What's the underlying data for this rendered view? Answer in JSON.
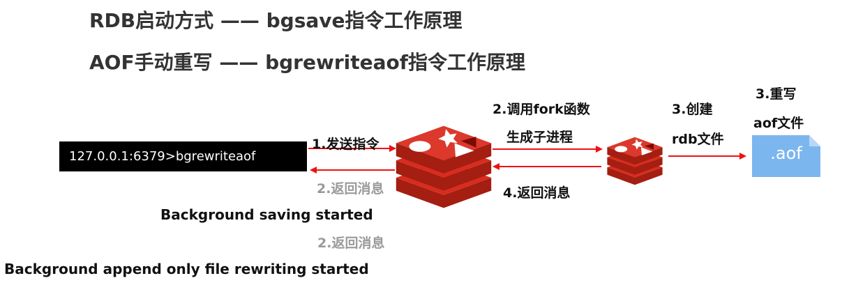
{
  "titles": {
    "rdb": "RDB启动方式 —— bgsave指令工作原理",
    "aof": "AOF手动重写 —— bgrewriteaof指令工作原理"
  },
  "client": {
    "command": "127.0.0.1:6379>bgrewriteaof"
  },
  "steps": {
    "send": "1.发送指令",
    "return_left": "2.返回消息",
    "fork_line1": "2.调用fork函数",
    "fork_line2": "生成子进程",
    "return_right": "4.返回消息",
    "create_line1": "3.创建",
    "create_line2": "rdb文件",
    "rewrite_line1": "3.重写",
    "rewrite_line2": "aof文件",
    "return_bottom": "2.返回消息"
  },
  "file": {
    "extension": ".aof",
    "icon": "document-icon",
    "color": "#7cb6ee"
  },
  "messages": {
    "bgsave": "Background saving started",
    "bgrewrite": "Background append only file rewriting started"
  },
  "colors": {
    "arrow": "#ee1111",
    "redis": "#d6281f",
    "gray_text": "#9a9a9a"
  }
}
